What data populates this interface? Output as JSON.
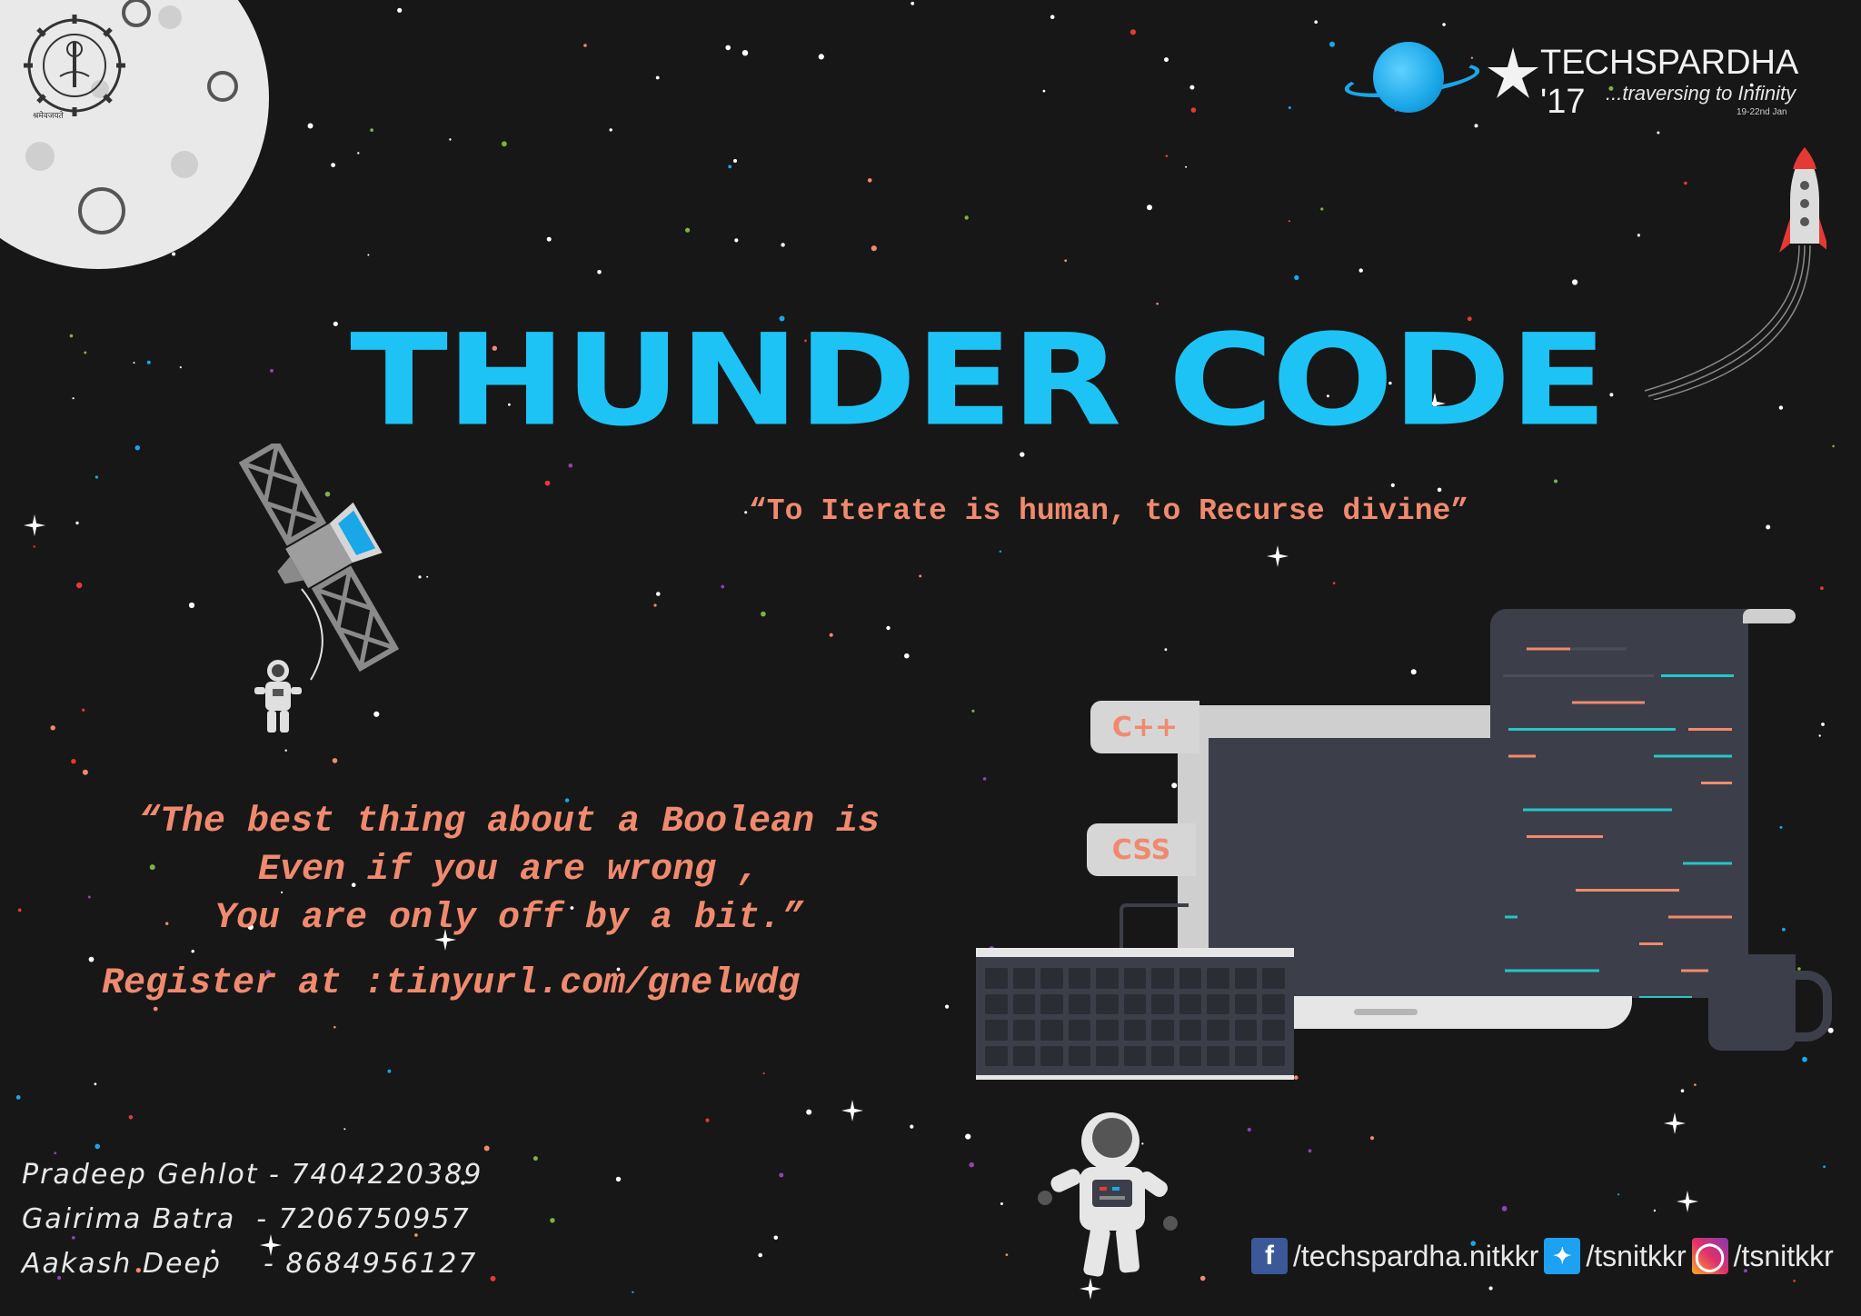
{
  "logo": {
    "lettering": "NATIONAL INSTITUTE OF TECHNOLOGY KURUKSHETRA",
    "motto": "श्रमेवजयते"
  },
  "brand": {
    "name": "TECHSPARDHA '17",
    "tagline": "...traversing to Infinity",
    "date": "19-22nd Jan"
  },
  "title": "THUNDER CODE",
  "subtitle": "“To Iterate is human, to Recurse divine”",
  "quote": {
    "line1": "“The best thing about a Boolean is",
    "line2": "Even if you are wrong ,",
    "line3": "You are only off by a bit.”"
  },
  "register": "Register at :tinyurl.com/gnelwdg",
  "contacts": [
    "Pradeep Gehlot - 7404220389",
    "Gairima Batra  - 7206750957",
    "Aakash Deep    - 8684956127"
  ],
  "social": {
    "facebook": "/techspardha.nitkkr",
    "twitter": "/tsnitkkr",
    "instagram": "/tsnitkkr"
  },
  "code_tags": [
    "C++",
    "CSS"
  ],
  "icons": [
    "moon-icon",
    "planet-icon",
    "rocket-icon",
    "satellite-icon",
    "astronaut-icon",
    "laptop-icon",
    "mug-icon",
    "facebook-icon",
    "twitter-icon",
    "instagram-icon"
  ],
  "colors": {
    "background": "#171717",
    "title": "#1ec3f5",
    "accent": "#f08a6e",
    "text": "#e8e8e8"
  }
}
